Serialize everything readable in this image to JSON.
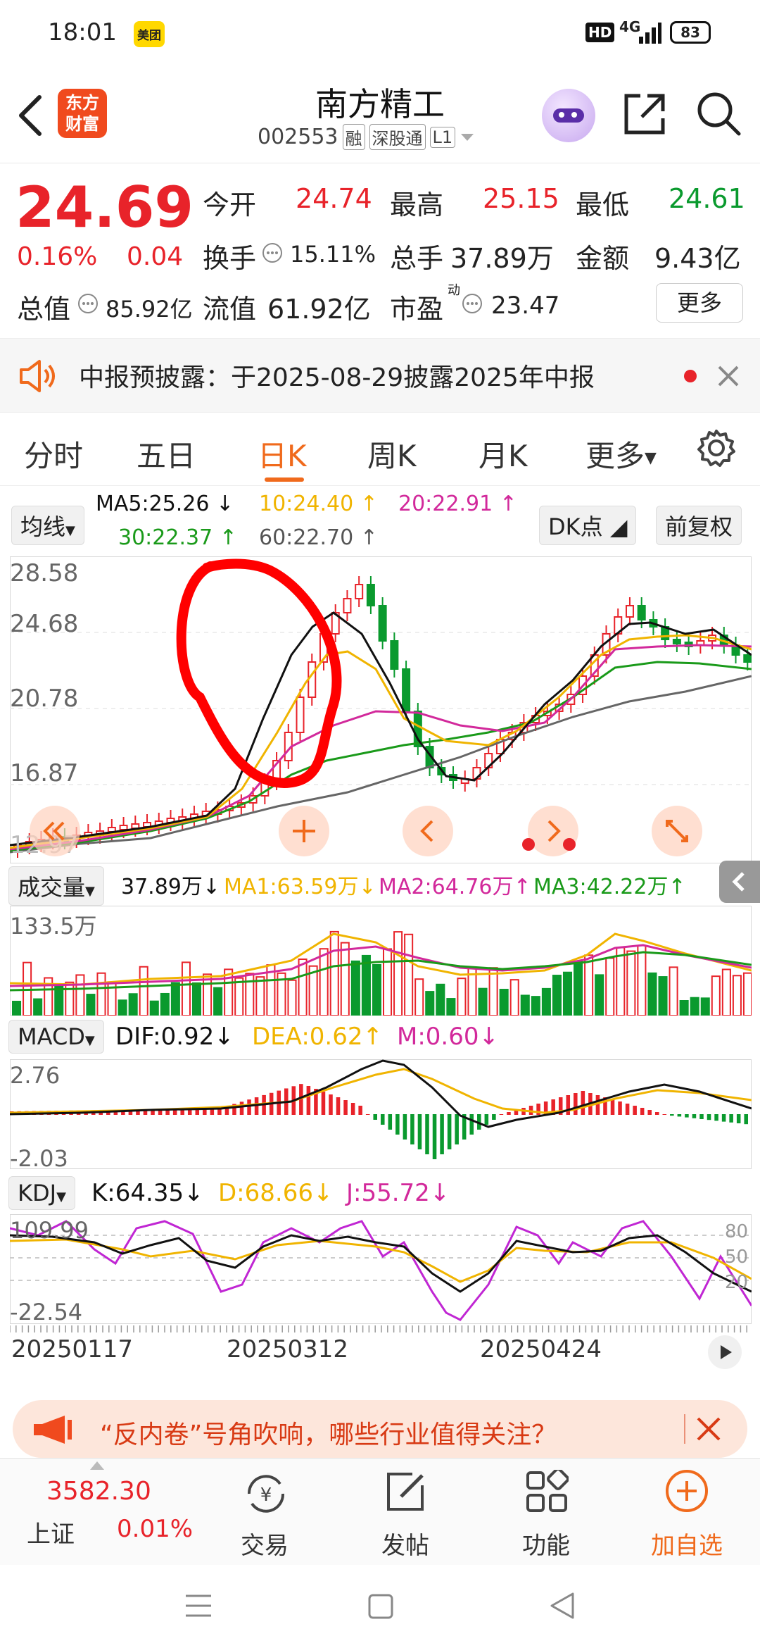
{
  "status_bar": {
    "time": "18:01",
    "app_badge": "美团",
    "hd": "HD",
    "network": "4G",
    "battery": "83"
  },
  "header": {
    "logo_line1": "东方",
    "logo_line2": "财富",
    "title": "南方精工",
    "code": "002553",
    "tag_rong": "融",
    "tag_sgt": "深股通",
    "tag_l1": "L1"
  },
  "quote": {
    "price": "24.69",
    "change_pct": "0.16%",
    "change": "0.04",
    "open_label": "今开",
    "open": "24.74",
    "high_label": "最高",
    "high": "25.15",
    "low_label": "最低",
    "low": "24.61",
    "turnover_label": "换手",
    "turnover": "15.11%",
    "volume_label": "总手",
    "volume": "37.89万",
    "amount_label": "金额",
    "amount": "9.43亿",
    "mktcap_label": "总值",
    "mktcap": "85.92亿",
    "float_label": "流值",
    "float": "61.92亿",
    "pe_label": "市盈",
    "pe_sup": "动",
    "pe": "23.47",
    "more": "更多"
  },
  "notice": {
    "text": "中报预披露：于2025-08-29披露2025年中报"
  },
  "tabs": [
    "分时",
    "五日",
    "日K",
    "周K",
    "月K",
    "更多"
  ],
  "active_tab": 2,
  "ma_legend": {
    "selector": "均线",
    "ma5": "MA5:25.26",
    "ma10": "10:24.40",
    "ma20": "20:22.91",
    "ma30": "30:22.37",
    "ma60": "60:22.70",
    "dk": "DK点",
    "fq": "前复权"
  },
  "price_axis": [
    "28.58",
    "24.68",
    "20.78",
    "16.87",
    "12.97"
  ],
  "volume": {
    "selector": "成交量",
    "value": "37.89万",
    "ma1": "MA1:63.59万",
    "ma2": "MA2:64.76万",
    "ma3": "MA3:42.22万",
    "axis_top": "133.5万"
  },
  "macd": {
    "selector": "MACD",
    "dif": "DIF:0.92",
    "dea": "DEA:0.62",
    "m": "M:0.60",
    "axis_top": "2.76",
    "axis_bottom": "-2.03"
  },
  "kdj": {
    "selector": "KDJ",
    "k": "K:64.35",
    "d": "D:68.66",
    "j": "J:55.72",
    "axis_top": "109.99",
    "axis_bottom": "-22.54",
    "ref_levels": [
      "80",
      "50",
      "20"
    ]
  },
  "dates": [
    "20250117",
    "20250312",
    "20250424"
  ],
  "banner": {
    "text": "“反内卷”号角吹响，哪些行业值得关注？"
  },
  "bottom_nav": {
    "index_value": "3582.30",
    "index_name": "上证",
    "index_change": "0.01%",
    "items": [
      "交易",
      "发帖",
      "功能",
      "加自选"
    ]
  },
  "colors": {
    "up": "#e8232a",
    "down": "#0a9a2e",
    "accent": "#f06a1c",
    "ma5": "#111111",
    "ma10": "#f0b400",
    "ma20": "#d2299b",
    "ma30": "#1a9a1a",
    "ma60": "#666666",
    "annotation": "#ff0000"
  }
}
